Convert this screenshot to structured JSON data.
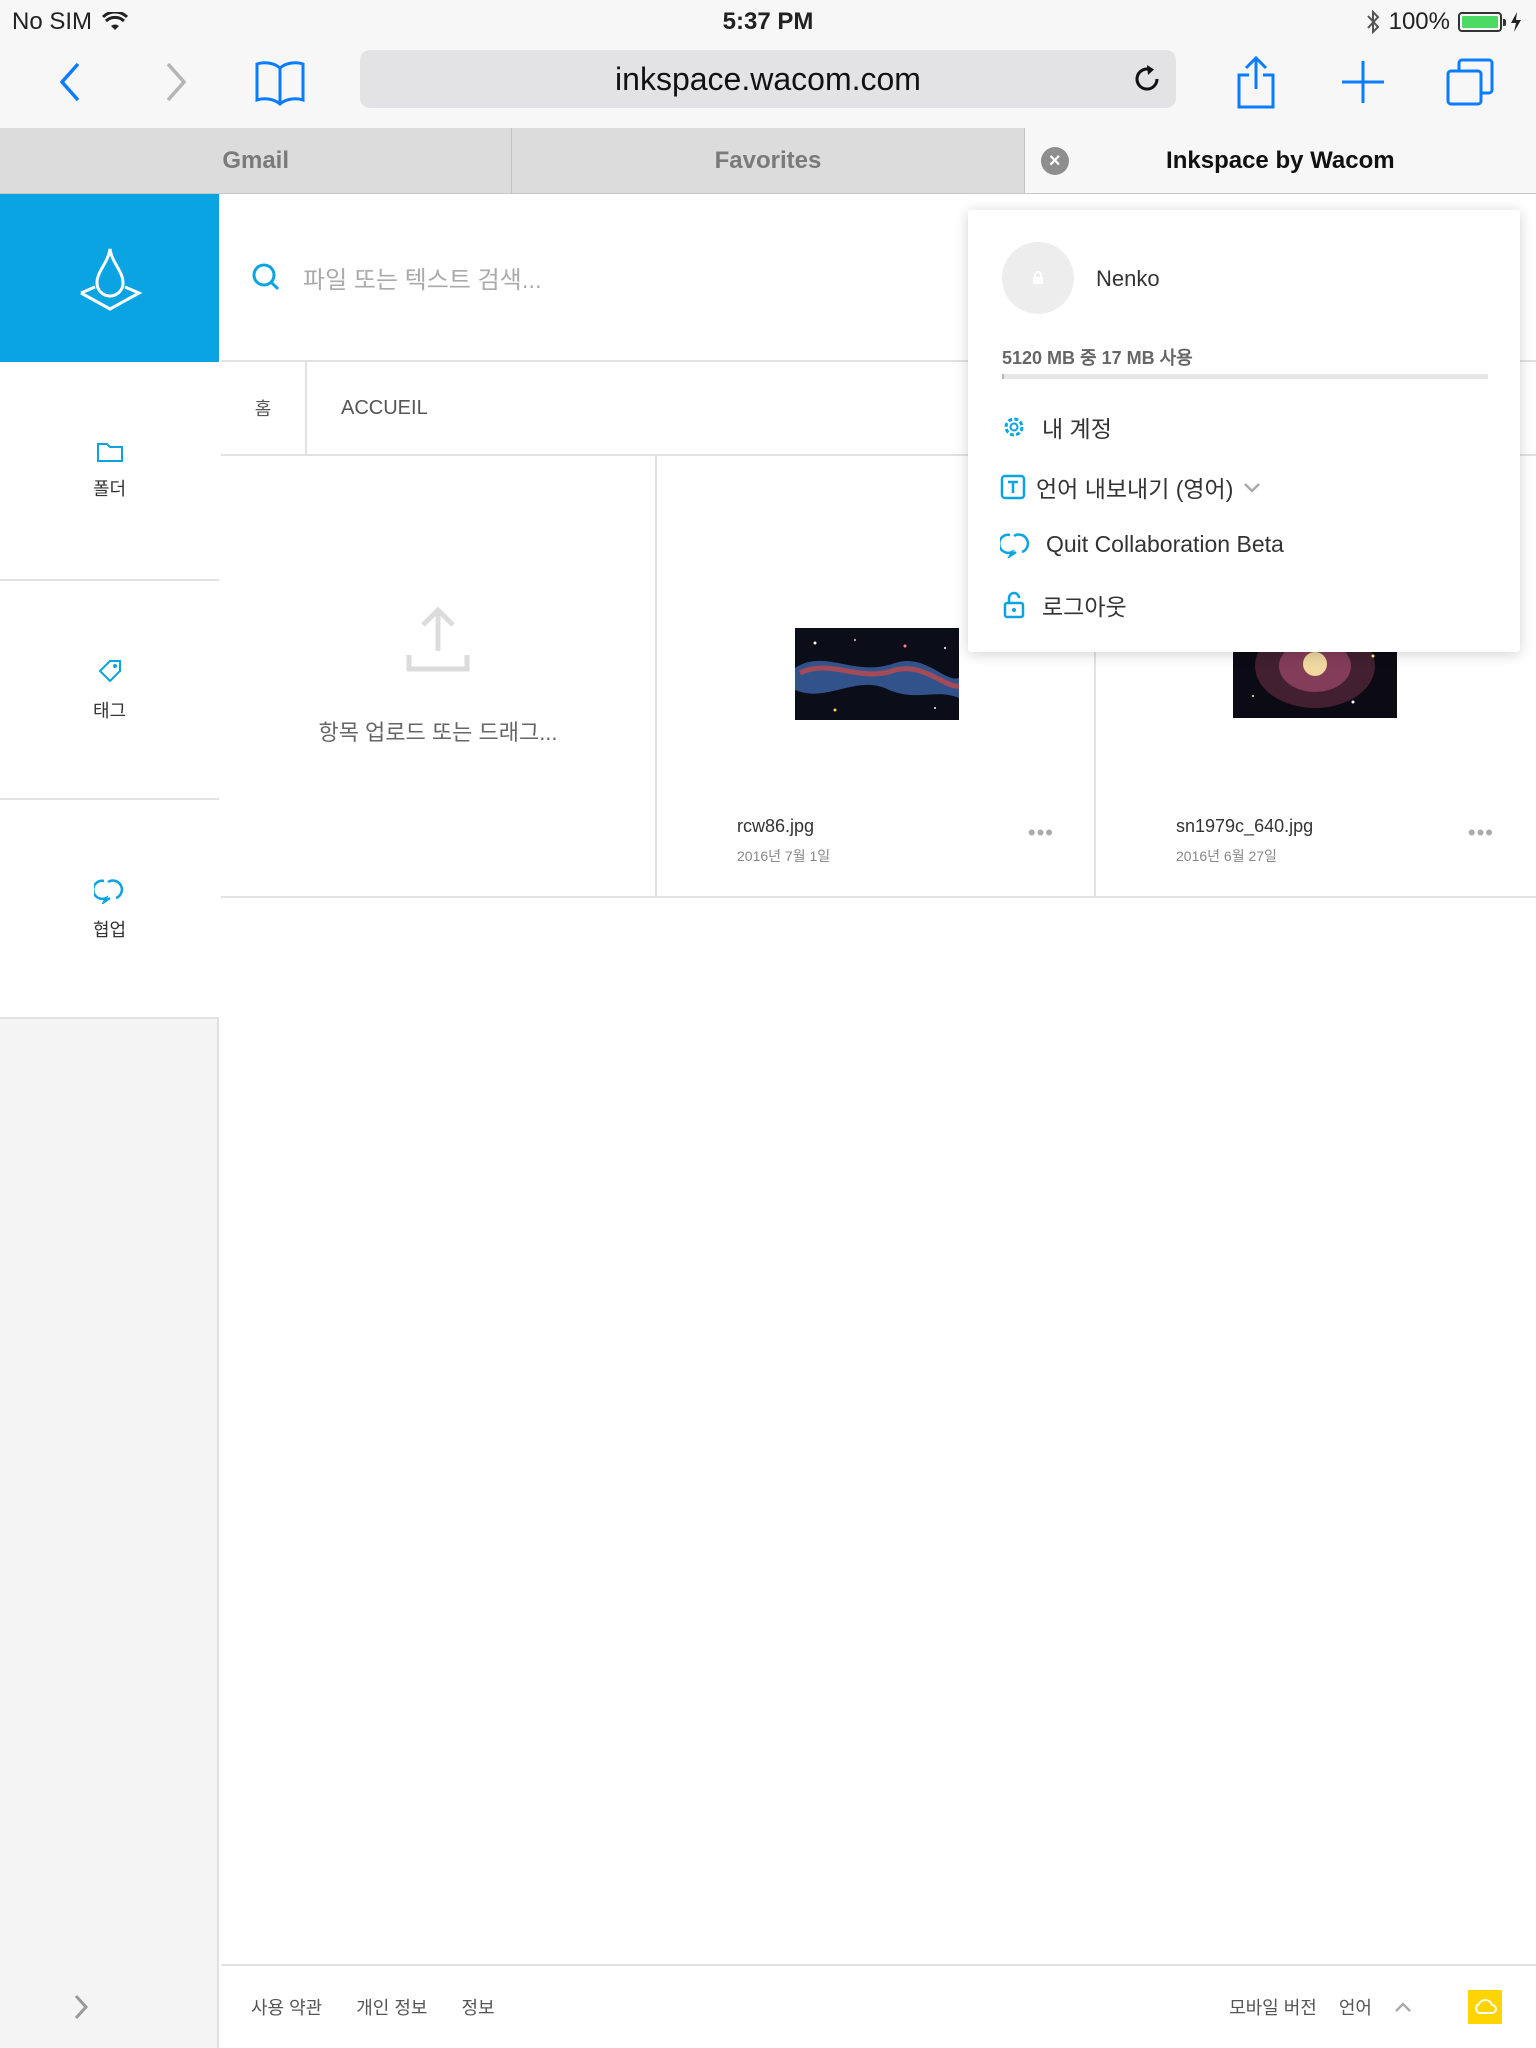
{
  "status": {
    "carrier": "No SIM",
    "time": "5:37 PM",
    "battery": "100%"
  },
  "browser": {
    "url": "inkspace.wacom.com",
    "tabs": [
      {
        "label": "Gmail"
      },
      {
        "label": "Favorites"
      },
      {
        "label": "Inkspace by Wacom"
      }
    ]
  },
  "sidebar": {
    "items": [
      {
        "label": "폴더"
      },
      {
        "label": "태그"
      },
      {
        "label": "협업"
      }
    ]
  },
  "search": {
    "placeholder": "파일 또는 텍스트 검색..."
  },
  "breadcrumb": {
    "home": "홈",
    "current": "ACCUEIL"
  },
  "upload": {
    "label": "항목 업로드 또는 드래그..."
  },
  "files": [
    {
      "name": "rcw86.jpg",
      "date": "2016년 7월 1일",
      "more": "•••"
    },
    {
      "name": "sn1979c_640.jpg",
      "date": "2016년 6월 27일",
      "more": "•••"
    }
  ],
  "footer": {
    "terms": "사용 약관",
    "privacy": "개인 정보",
    "info": "정보",
    "mobile": "모바일 버전",
    "language": "언어"
  },
  "account_menu": {
    "username": "Nenko",
    "storage_text": "5120 MB 중 17 MB 사용",
    "storage_used_fraction": 0.0033,
    "items": [
      {
        "label": "내 계정",
        "icon": "gear-icon"
      },
      {
        "label": "언어 내보내기 (영어)",
        "icon": "text-icon"
      },
      {
        "label": "Quit Collaboration Beta",
        "icon": "collaboration-icon"
      },
      {
        "label": "로그아웃",
        "icon": "unlock-icon"
      }
    ]
  },
  "colors": {
    "accent": "#0aa4e3",
    "brand_yellow": "#ffd400"
  }
}
